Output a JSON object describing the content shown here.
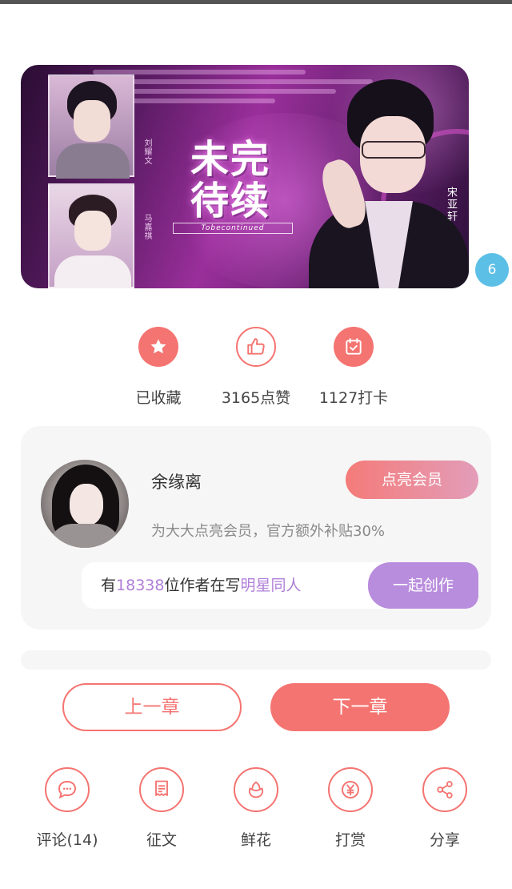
{
  "banner": {
    "title_line1": "未完",
    "title_line2": "待续",
    "subtitle": "Tobecontinued",
    "character_name": "宋亚轩",
    "side_name_a": "刘耀文",
    "side_name_b": "马嘉祺"
  },
  "badge": {
    "count": "6"
  },
  "actions": [
    {
      "label": "已收藏",
      "icon": "star-icon",
      "style": "filled"
    },
    {
      "label": "3165点赞",
      "icon": "thumbs-up-icon",
      "style": "outline"
    },
    {
      "label": "1127打卡",
      "icon": "calendar-check-icon",
      "style": "filled"
    }
  ],
  "member": {
    "username": "余缘离",
    "vip_button": "点亮会员",
    "vip_desc": "为大大点亮会员，官方额外补贴30%",
    "writers_prefix": "有",
    "writers_count": "18338",
    "writers_middle": "位作者在写",
    "writers_topic": "明星同人",
    "create_button": "一起创作"
  },
  "nav": {
    "prev": "上一章",
    "next": "下一章"
  },
  "tools": [
    {
      "label": "评论(14)",
      "icon": "comment-icon"
    },
    {
      "label": "征文",
      "icon": "contest-scroll-icon"
    },
    {
      "label": "鲜花",
      "icon": "flower-icon"
    },
    {
      "label": "打赏",
      "icon": "yen-coin-icon"
    },
    {
      "label": "分享",
      "icon": "share-icon"
    }
  ],
  "colors": {
    "accent": "#f47471",
    "purple": "#b98ddd",
    "badge": "#5bbfe6"
  }
}
